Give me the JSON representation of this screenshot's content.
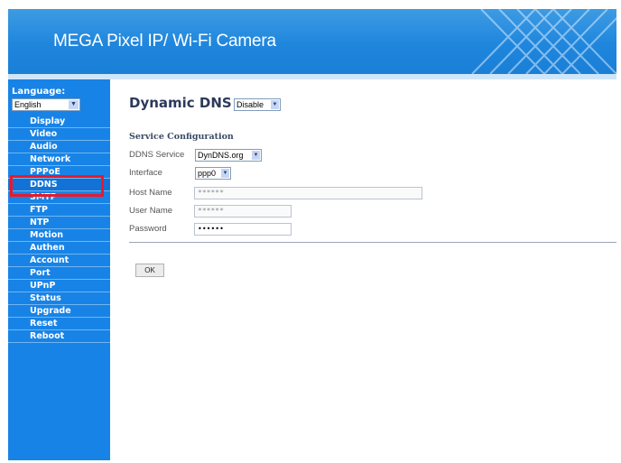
{
  "header": {
    "title": "MEGA Pixel IP/ Wi-Fi Camera"
  },
  "sidebar": {
    "language_label": "Language:",
    "language_value": "English",
    "items": [
      {
        "label": "Display"
      },
      {
        "label": "Video"
      },
      {
        "label": "Audio"
      },
      {
        "label": "Network"
      },
      {
        "label": "PPPoE"
      },
      {
        "label": "DDNS"
      },
      {
        "label": "SMTP"
      },
      {
        "label": "FTP"
      },
      {
        "label": "NTP"
      },
      {
        "label": "Motion"
      },
      {
        "label": "Authen"
      },
      {
        "label": "Account"
      },
      {
        "label": "Port"
      },
      {
        "label": "UPnP"
      },
      {
        "label": "Status"
      },
      {
        "label": "Upgrade"
      },
      {
        "label": "Reset"
      },
      {
        "label": "Reboot"
      }
    ],
    "active": "DDNS"
  },
  "main": {
    "title": "Dynamic DNS",
    "enable_select": "Disable",
    "section_title": "Service Configuration",
    "fields": {
      "ddns_service": {
        "label": "DDNS Service",
        "value": "DynDNS.org"
      },
      "interface": {
        "label": "Interface",
        "value": "ppp0"
      },
      "host_name": {
        "label": "Host Name",
        "value": "******"
      },
      "user_name": {
        "label": "User Name",
        "value": "******"
      },
      "password": {
        "label": "Password",
        "value": "••••••"
      }
    },
    "ok_label": "OK"
  },
  "colors": {
    "sidebar": "#1883e6",
    "header": "#1f86dd",
    "highlight": "#e8192c"
  }
}
